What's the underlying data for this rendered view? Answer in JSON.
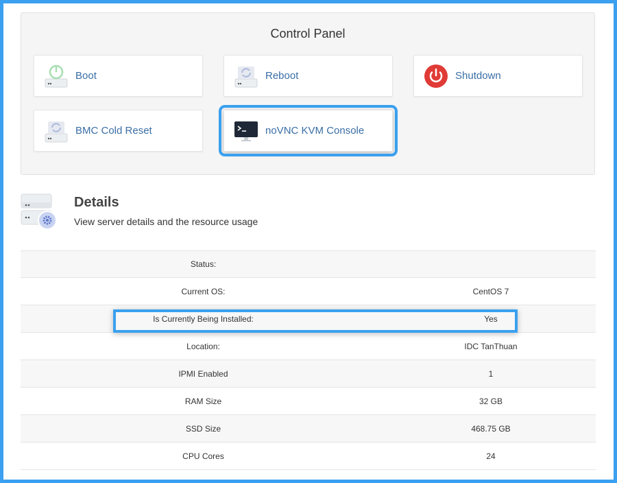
{
  "control_panel": {
    "title": "Control Panel",
    "buttons": [
      {
        "label": "Boot",
        "icon": "power-server-icon"
      },
      {
        "label": "Reboot",
        "icon": "refresh-server-icon"
      },
      {
        "label": "Shutdown",
        "icon": "power-off-icon"
      },
      {
        "label": "BMC Cold Reset",
        "icon": "refresh-server-icon"
      },
      {
        "label": "noVNC KVM Console",
        "icon": "terminal-monitor-icon"
      }
    ]
  },
  "details": {
    "title": "Details",
    "subtitle": "View server details and the resource usage"
  },
  "rows": [
    {
      "key": "Status:",
      "value": ""
    },
    {
      "key": "Current OS:",
      "value": "CentOS 7"
    },
    {
      "key": "Is Currently Being Installed:",
      "value": "Yes"
    },
    {
      "key": "Location:",
      "value": "IDC TanThuan"
    },
    {
      "key": "IPMI Enabled",
      "value": "1"
    },
    {
      "key": "RAM Size",
      "value": "32 GB"
    },
    {
      "key": "SSD Size",
      "value": "468.75 GB"
    },
    {
      "key": "CPU Cores",
      "value": "24"
    }
  ],
  "colors": {
    "accent": "#3aa0ef",
    "link": "#3a6ea5",
    "danger": "#e03b36"
  }
}
